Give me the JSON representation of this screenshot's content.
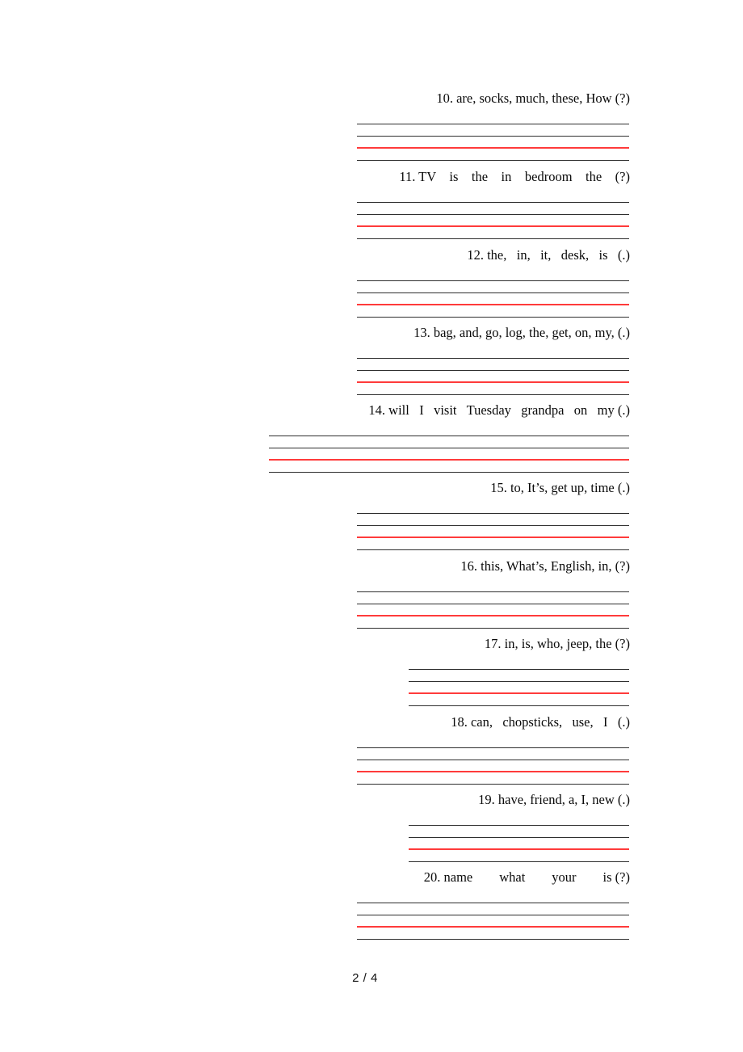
{
  "document": {
    "page_label": "2 / 4",
    "line_colors": {
      "dark": "#2f2f2f",
      "red": "#ff3b3b"
    }
  },
  "exercises": [
    {
      "number": "10.",
      "prompt": "10. are, socks, much, these, How (?)",
      "lines": [
        "dark",
        "dark",
        "red",
        "dark"
      ]
    },
    {
      "number": "11.",
      "prompt": "11. TV    is    the    in    bedroom    the    (?)",
      "lines": [
        "dark",
        "dark",
        "red",
        "dark"
      ]
    },
    {
      "number": "12.",
      "prompt": "12. the,   in,   it,   desk,   is   (.)",
      "lines": [
        "dark",
        "dark",
        "red",
        "dark"
      ]
    },
    {
      "number": "13.",
      "prompt": "13. bag, and, go, log, the, get, on, my, (.)",
      "lines": [
        "dark",
        "dark",
        "red",
        "dark"
      ]
    },
    {
      "number": "14.",
      "prompt": "14. will   I   visit   Tuesday   grandpa   on   my (.)",
      "lines": [
        "dark",
        "dark",
        "red",
        "dark"
      ]
    },
    {
      "number": "15.",
      "prompt": "15. to, It’s, get up, time (.)",
      "lines": [
        "dark",
        "dark",
        "red",
        "dark"
      ]
    },
    {
      "number": "16.",
      "prompt": "16. this, What’s, English, in, (?)",
      "lines": [
        "dark",
        "dark",
        "red",
        "dark"
      ]
    },
    {
      "number": "17.",
      "prompt": "17. in, is, who, jeep, the (?)",
      "lines": [
        "dark",
        "dark",
        "red",
        "dark"
      ]
    },
    {
      "number": "18.",
      "prompt": "18. can,   chopsticks,   use,   I   (.)",
      "lines": [
        "dark",
        "dark",
        "red",
        "dark"
      ]
    },
    {
      "number": "19.",
      "prompt": "19. have, friend, a, I, new (.)",
      "lines": [
        "dark",
        "dark",
        "red",
        "dark"
      ]
    },
    {
      "number": "20.",
      "prompt": "20. name        what        your        is (?)",
      "lines": [
        "dark",
        "dark",
        "red",
        "dark"
      ]
    }
  ]
}
